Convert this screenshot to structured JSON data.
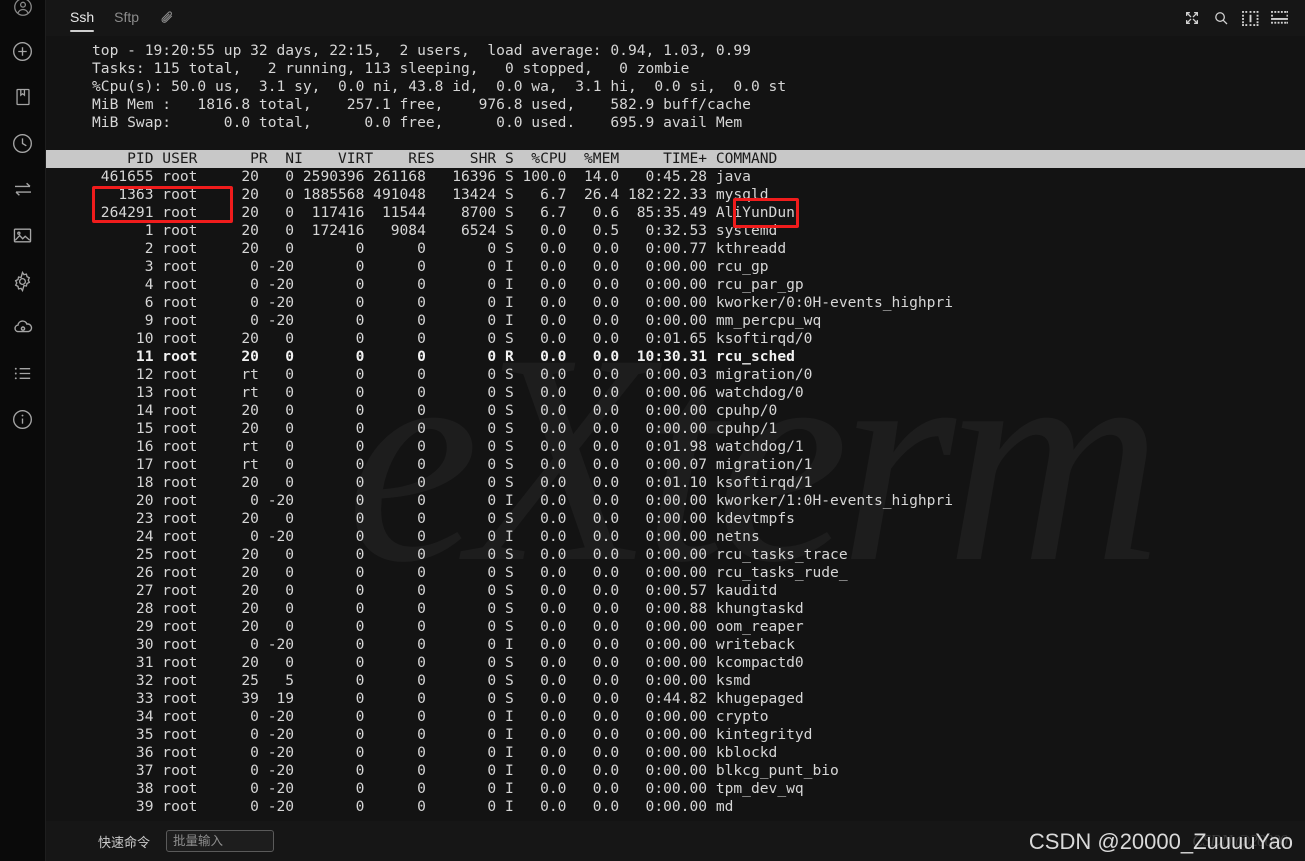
{
  "rail": {
    "icons": [
      {
        "name": "account-circle-icon",
        "label": "Account"
      },
      {
        "name": "add-circle-icon",
        "label": "New session"
      },
      {
        "name": "bookmark-icon",
        "label": "Bookmarks"
      },
      {
        "name": "clock-icon",
        "label": "History"
      },
      {
        "name": "transfer-icon",
        "label": "Transfer"
      },
      {
        "name": "image-icon",
        "label": "Snapshots"
      },
      {
        "name": "gear-icon",
        "label": "Settings"
      },
      {
        "name": "cloud-icon",
        "label": "Cloud"
      },
      {
        "name": "list-icon",
        "label": "Sessions list"
      },
      {
        "name": "info-icon",
        "label": "About"
      }
    ]
  },
  "tabbar": {
    "tabs": [
      {
        "label": "Ssh",
        "active": true
      },
      {
        "label": "Sftp",
        "active": false
      }
    ],
    "attach_icon": "paperclip-icon",
    "right_icons": [
      {
        "name": "fullscreen-icon",
        "label": "Fullscreen"
      },
      {
        "name": "search-icon",
        "label": "Search"
      },
      {
        "name": "split-vertical-icon",
        "label": "Split vertical"
      },
      {
        "name": "split-horizontal-icon",
        "label": "Split horizontal"
      }
    ]
  },
  "terminal": {
    "watermark": "eXterm",
    "summary": [
      "top - 19:20:55 up 32 days, 22:15,  2 users,  load average: 0.94, 1.03, 0.99",
      "Tasks: 115 total,   2 running, 113 sleeping,   0 stopped,   0 zombie",
      "%Cpu(s): 50.0 us,  3.1 sy,  0.0 ni, 43.8 id,  0.0 wa,  3.1 hi,  0.0 si,  0.0 st",
      "MiB Mem :   1816.8 total,    257.1 free,    976.8 used,    582.9 buff/cache",
      "MiB Swap:      0.0 total,      0.0 free,      0.0 used.    695.9 avail Mem",
      ""
    ],
    "header": "    PID USER      PR  NI    VIRT    RES    SHR S  %CPU  %MEM     TIME+ COMMAND",
    "columns": [
      "PID",
      "USER",
      "PR",
      "NI",
      "VIRT",
      "RES",
      "SHR",
      "S",
      "%CPU",
      "%MEM",
      "TIME+",
      "COMMAND"
    ],
    "rows": [
      {
        "pid": "461655",
        "user": "root",
        "pr": "20",
        "ni": "0",
        "virt": "2590396",
        "res": "261168",
        "shr": "16396",
        "s": "S",
        "cpu": "100.0",
        "mem": "14.0",
        "time": "0:45.28",
        "command": "java",
        "bold": false
      },
      {
        "pid": "1363",
        "user": "root",
        "pr": "20",
        "ni": "0",
        "virt": "1885568",
        "res": "491048",
        "shr": "13424",
        "s": "S",
        "cpu": "6.7",
        "mem": "26.4",
        "time": "182:22.33",
        "command": "mysqld",
        "bold": false
      },
      {
        "pid": "264291",
        "user": "root",
        "pr": "20",
        "ni": "0",
        "virt": "117416",
        "res": "11544",
        "shr": "8700",
        "s": "S",
        "cpu": "6.7",
        "mem": "0.6",
        "time": "85:35.49",
        "command": "AliYunDun",
        "bold": false
      },
      {
        "pid": "1",
        "user": "root",
        "pr": "20",
        "ni": "0",
        "virt": "172416",
        "res": "9084",
        "shr": "6524",
        "s": "S",
        "cpu": "0.0",
        "mem": "0.5",
        "time": "0:32.53",
        "command": "systemd",
        "bold": false
      },
      {
        "pid": "2",
        "user": "root",
        "pr": "20",
        "ni": "0",
        "virt": "0",
        "res": "0",
        "shr": "0",
        "s": "S",
        "cpu": "0.0",
        "mem": "0.0",
        "time": "0:00.77",
        "command": "kthreadd",
        "bold": false
      },
      {
        "pid": "3",
        "user": "root",
        "pr": "0",
        "ni": "-20",
        "virt": "0",
        "res": "0",
        "shr": "0",
        "s": "I",
        "cpu": "0.0",
        "mem": "0.0",
        "time": "0:00.00",
        "command": "rcu_gp",
        "bold": false
      },
      {
        "pid": "4",
        "user": "root",
        "pr": "0",
        "ni": "-20",
        "virt": "0",
        "res": "0",
        "shr": "0",
        "s": "I",
        "cpu": "0.0",
        "mem": "0.0",
        "time": "0:00.00",
        "command": "rcu_par_gp",
        "bold": false
      },
      {
        "pid": "6",
        "user": "root",
        "pr": "0",
        "ni": "-20",
        "virt": "0",
        "res": "0",
        "shr": "0",
        "s": "I",
        "cpu": "0.0",
        "mem": "0.0",
        "time": "0:00.00",
        "command": "kworker/0:0H-events_highpri",
        "bold": false
      },
      {
        "pid": "9",
        "user": "root",
        "pr": "0",
        "ni": "-20",
        "virt": "0",
        "res": "0",
        "shr": "0",
        "s": "I",
        "cpu": "0.0",
        "mem": "0.0",
        "time": "0:00.00",
        "command": "mm_percpu_wq",
        "bold": false
      },
      {
        "pid": "10",
        "user": "root",
        "pr": "20",
        "ni": "0",
        "virt": "0",
        "res": "0",
        "shr": "0",
        "s": "S",
        "cpu": "0.0",
        "mem": "0.0",
        "time": "0:01.65",
        "command": "ksoftirqd/0",
        "bold": false
      },
      {
        "pid": "11",
        "user": "root",
        "pr": "20",
        "ni": "0",
        "virt": "0",
        "res": "0",
        "shr": "0",
        "s": "R",
        "cpu": "0.0",
        "mem": "0.0",
        "time": "10:30.31",
        "command": "rcu_sched",
        "bold": true
      },
      {
        "pid": "12",
        "user": "root",
        "pr": "rt",
        "ni": "0",
        "virt": "0",
        "res": "0",
        "shr": "0",
        "s": "S",
        "cpu": "0.0",
        "mem": "0.0",
        "time": "0:00.03",
        "command": "migration/0",
        "bold": false
      },
      {
        "pid": "13",
        "user": "root",
        "pr": "rt",
        "ni": "0",
        "virt": "0",
        "res": "0",
        "shr": "0",
        "s": "S",
        "cpu": "0.0",
        "mem": "0.0",
        "time": "0:00.06",
        "command": "watchdog/0",
        "bold": false
      },
      {
        "pid": "14",
        "user": "root",
        "pr": "20",
        "ni": "0",
        "virt": "0",
        "res": "0",
        "shr": "0",
        "s": "S",
        "cpu": "0.0",
        "mem": "0.0",
        "time": "0:00.00",
        "command": "cpuhp/0",
        "bold": false
      },
      {
        "pid": "15",
        "user": "root",
        "pr": "20",
        "ni": "0",
        "virt": "0",
        "res": "0",
        "shr": "0",
        "s": "S",
        "cpu": "0.0",
        "mem": "0.0",
        "time": "0:00.00",
        "command": "cpuhp/1",
        "bold": false
      },
      {
        "pid": "16",
        "user": "root",
        "pr": "rt",
        "ni": "0",
        "virt": "0",
        "res": "0",
        "shr": "0",
        "s": "S",
        "cpu": "0.0",
        "mem": "0.0",
        "time": "0:01.98",
        "command": "watchdog/1",
        "bold": false
      },
      {
        "pid": "17",
        "user": "root",
        "pr": "rt",
        "ni": "0",
        "virt": "0",
        "res": "0",
        "shr": "0",
        "s": "S",
        "cpu": "0.0",
        "mem": "0.0",
        "time": "0:00.07",
        "command": "migration/1",
        "bold": false
      },
      {
        "pid": "18",
        "user": "root",
        "pr": "20",
        "ni": "0",
        "virt": "0",
        "res": "0",
        "shr": "0",
        "s": "S",
        "cpu": "0.0",
        "mem": "0.0",
        "time": "0:01.10",
        "command": "ksoftirqd/1",
        "bold": false
      },
      {
        "pid": "20",
        "user": "root",
        "pr": "0",
        "ni": "-20",
        "virt": "0",
        "res": "0",
        "shr": "0",
        "s": "I",
        "cpu": "0.0",
        "mem": "0.0",
        "time": "0:00.00",
        "command": "kworker/1:0H-events_highpri",
        "bold": false
      },
      {
        "pid": "23",
        "user": "root",
        "pr": "20",
        "ni": "0",
        "virt": "0",
        "res": "0",
        "shr": "0",
        "s": "S",
        "cpu": "0.0",
        "mem": "0.0",
        "time": "0:00.00",
        "command": "kdevtmpfs",
        "bold": false
      },
      {
        "pid": "24",
        "user": "root",
        "pr": "0",
        "ni": "-20",
        "virt": "0",
        "res": "0",
        "shr": "0",
        "s": "I",
        "cpu": "0.0",
        "mem": "0.0",
        "time": "0:00.00",
        "command": "netns",
        "bold": false
      },
      {
        "pid": "25",
        "user": "root",
        "pr": "20",
        "ni": "0",
        "virt": "0",
        "res": "0",
        "shr": "0",
        "s": "S",
        "cpu": "0.0",
        "mem": "0.0",
        "time": "0:00.00",
        "command": "rcu_tasks_trace",
        "bold": false
      },
      {
        "pid": "26",
        "user": "root",
        "pr": "20",
        "ni": "0",
        "virt": "0",
        "res": "0",
        "shr": "0",
        "s": "S",
        "cpu": "0.0",
        "mem": "0.0",
        "time": "0:00.00",
        "command": "rcu_tasks_rude_",
        "bold": false
      },
      {
        "pid": "27",
        "user": "root",
        "pr": "20",
        "ni": "0",
        "virt": "0",
        "res": "0",
        "shr": "0",
        "s": "S",
        "cpu": "0.0",
        "mem": "0.0",
        "time": "0:00.57",
        "command": "kauditd",
        "bold": false
      },
      {
        "pid": "28",
        "user": "root",
        "pr": "20",
        "ni": "0",
        "virt": "0",
        "res": "0",
        "shr": "0",
        "s": "S",
        "cpu": "0.0",
        "mem": "0.0",
        "time": "0:00.88",
        "command": "khungtaskd",
        "bold": false
      },
      {
        "pid": "29",
        "user": "root",
        "pr": "20",
        "ni": "0",
        "virt": "0",
        "res": "0",
        "shr": "0",
        "s": "S",
        "cpu": "0.0",
        "mem": "0.0",
        "time": "0:00.00",
        "command": "oom_reaper",
        "bold": false
      },
      {
        "pid": "30",
        "user": "root",
        "pr": "0",
        "ni": "-20",
        "virt": "0",
        "res": "0",
        "shr": "0",
        "s": "I",
        "cpu": "0.0",
        "mem": "0.0",
        "time": "0:00.00",
        "command": "writeback",
        "bold": false
      },
      {
        "pid": "31",
        "user": "root",
        "pr": "20",
        "ni": "0",
        "virt": "0",
        "res": "0",
        "shr": "0",
        "s": "S",
        "cpu": "0.0",
        "mem": "0.0",
        "time": "0:00.00",
        "command": "kcompactd0",
        "bold": false
      },
      {
        "pid": "32",
        "user": "root",
        "pr": "25",
        "ni": "5",
        "virt": "0",
        "res": "0",
        "shr": "0",
        "s": "S",
        "cpu": "0.0",
        "mem": "0.0",
        "time": "0:00.00",
        "command": "ksmd",
        "bold": false
      },
      {
        "pid": "33",
        "user": "root",
        "pr": "39",
        "ni": "19",
        "virt": "0",
        "res": "0",
        "shr": "0",
        "s": "S",
        "cpu": "0.0",
        "mem": "0.0",
        "time": "0:44.82",
        "command": "khugepaged",
        "bold": false
      },
      {
        "pid": "34",
        "user": "root",
        "pr": "0",
        "ni": "-20",
        "virt": "0",
        "res": "0",
        "shr": "0",
        "s": "I",
        "cpu": "0.0",
        "mem": "0.0",
        "time": "0:00.00",
        "command": "crypto",
        "bold": false
      },
      {
        "pid": "35",
        "user": "root",
        "pr": "0",
        "ni": "-20",
        "virt": "0",
        "res": "0",
        "shr": "0",
        "s": "I",
        "cpu": "0.0",
        "mem": "0.0",
        "time": "0:00.00",
        "command": "kintegrityd",
        "bold": false
      },
      {
        "pid": "36",
        "user": "root",
        "pr": "0",
        "ni": "-20",
        "virt": "0",
        "res": "0",
        "shr": "0",
        "s": "I",
        "cpu": "0.0",
        "mem": "0.0",
        "time": "0:00.00",
        "command": "kblockd",
        "bold": false
      },
      {
        "pid": "37",
        "user": "root",
        "pr": "0",
        "ni": "-20",
        "virt": "0",
        "res": "0",
        "shr": "0",
        "s": "I",
        "cpu": "0.0",
        "mem": "0.0",
        "time": "0:00.00",
        "command": "blkcg_punt_bio",
        "bold": false
      },
      {
        "pid": "38",
        "user": "root",
        "pr": "0",
        "ni": "-20",
        "virt": "0",
        "res": "0",
        "shr": "0",
        "s": "I",
        "cpu": "0.0",
        "mem": "0.0",
        "time": "0:00.00",
        "command": "tpm_dev_wq",
        "bold": false
      },
      {
        "pid": "39",
        "user": "root",
        "pr": "0",
        "ni": "-20",
        "virt": "0",
        "res": "0",
        "shr": "0",
        "s": "I",
        "cpu": "0.0",
        "mem": "0.0",
        "time": "0:00.00",
        "command": "md",
        "bold": false
      }
    ],
    "annotations": [
      {
        "name": "pid-user-highlight",
        "color": "#f01c1c"
      },
      {
        "name": "java-command-highlight",
        "color": "#f01c1c"
      }
    ]
  },
  "bottombar": {
    "quick_command_label": "快速命令",
    "batch_input_placeholder": "批量输入",
    "batch_input_value": ""
  },
  "credit": {
    "text": "CSDN @20000_ZuuuuYao",
    "watermark": "CSDN @20000"
  },
  "colors": {
    "terminal_bg": "#131313",
    "rail_bg": "#0a0a0a",
    "chrome_bg": "#161616",
    "header_row_bg": "#c8c8c8",
    "text": "#d6d6d6",
    "annotation_red": "#f01c1c"
  }
}
